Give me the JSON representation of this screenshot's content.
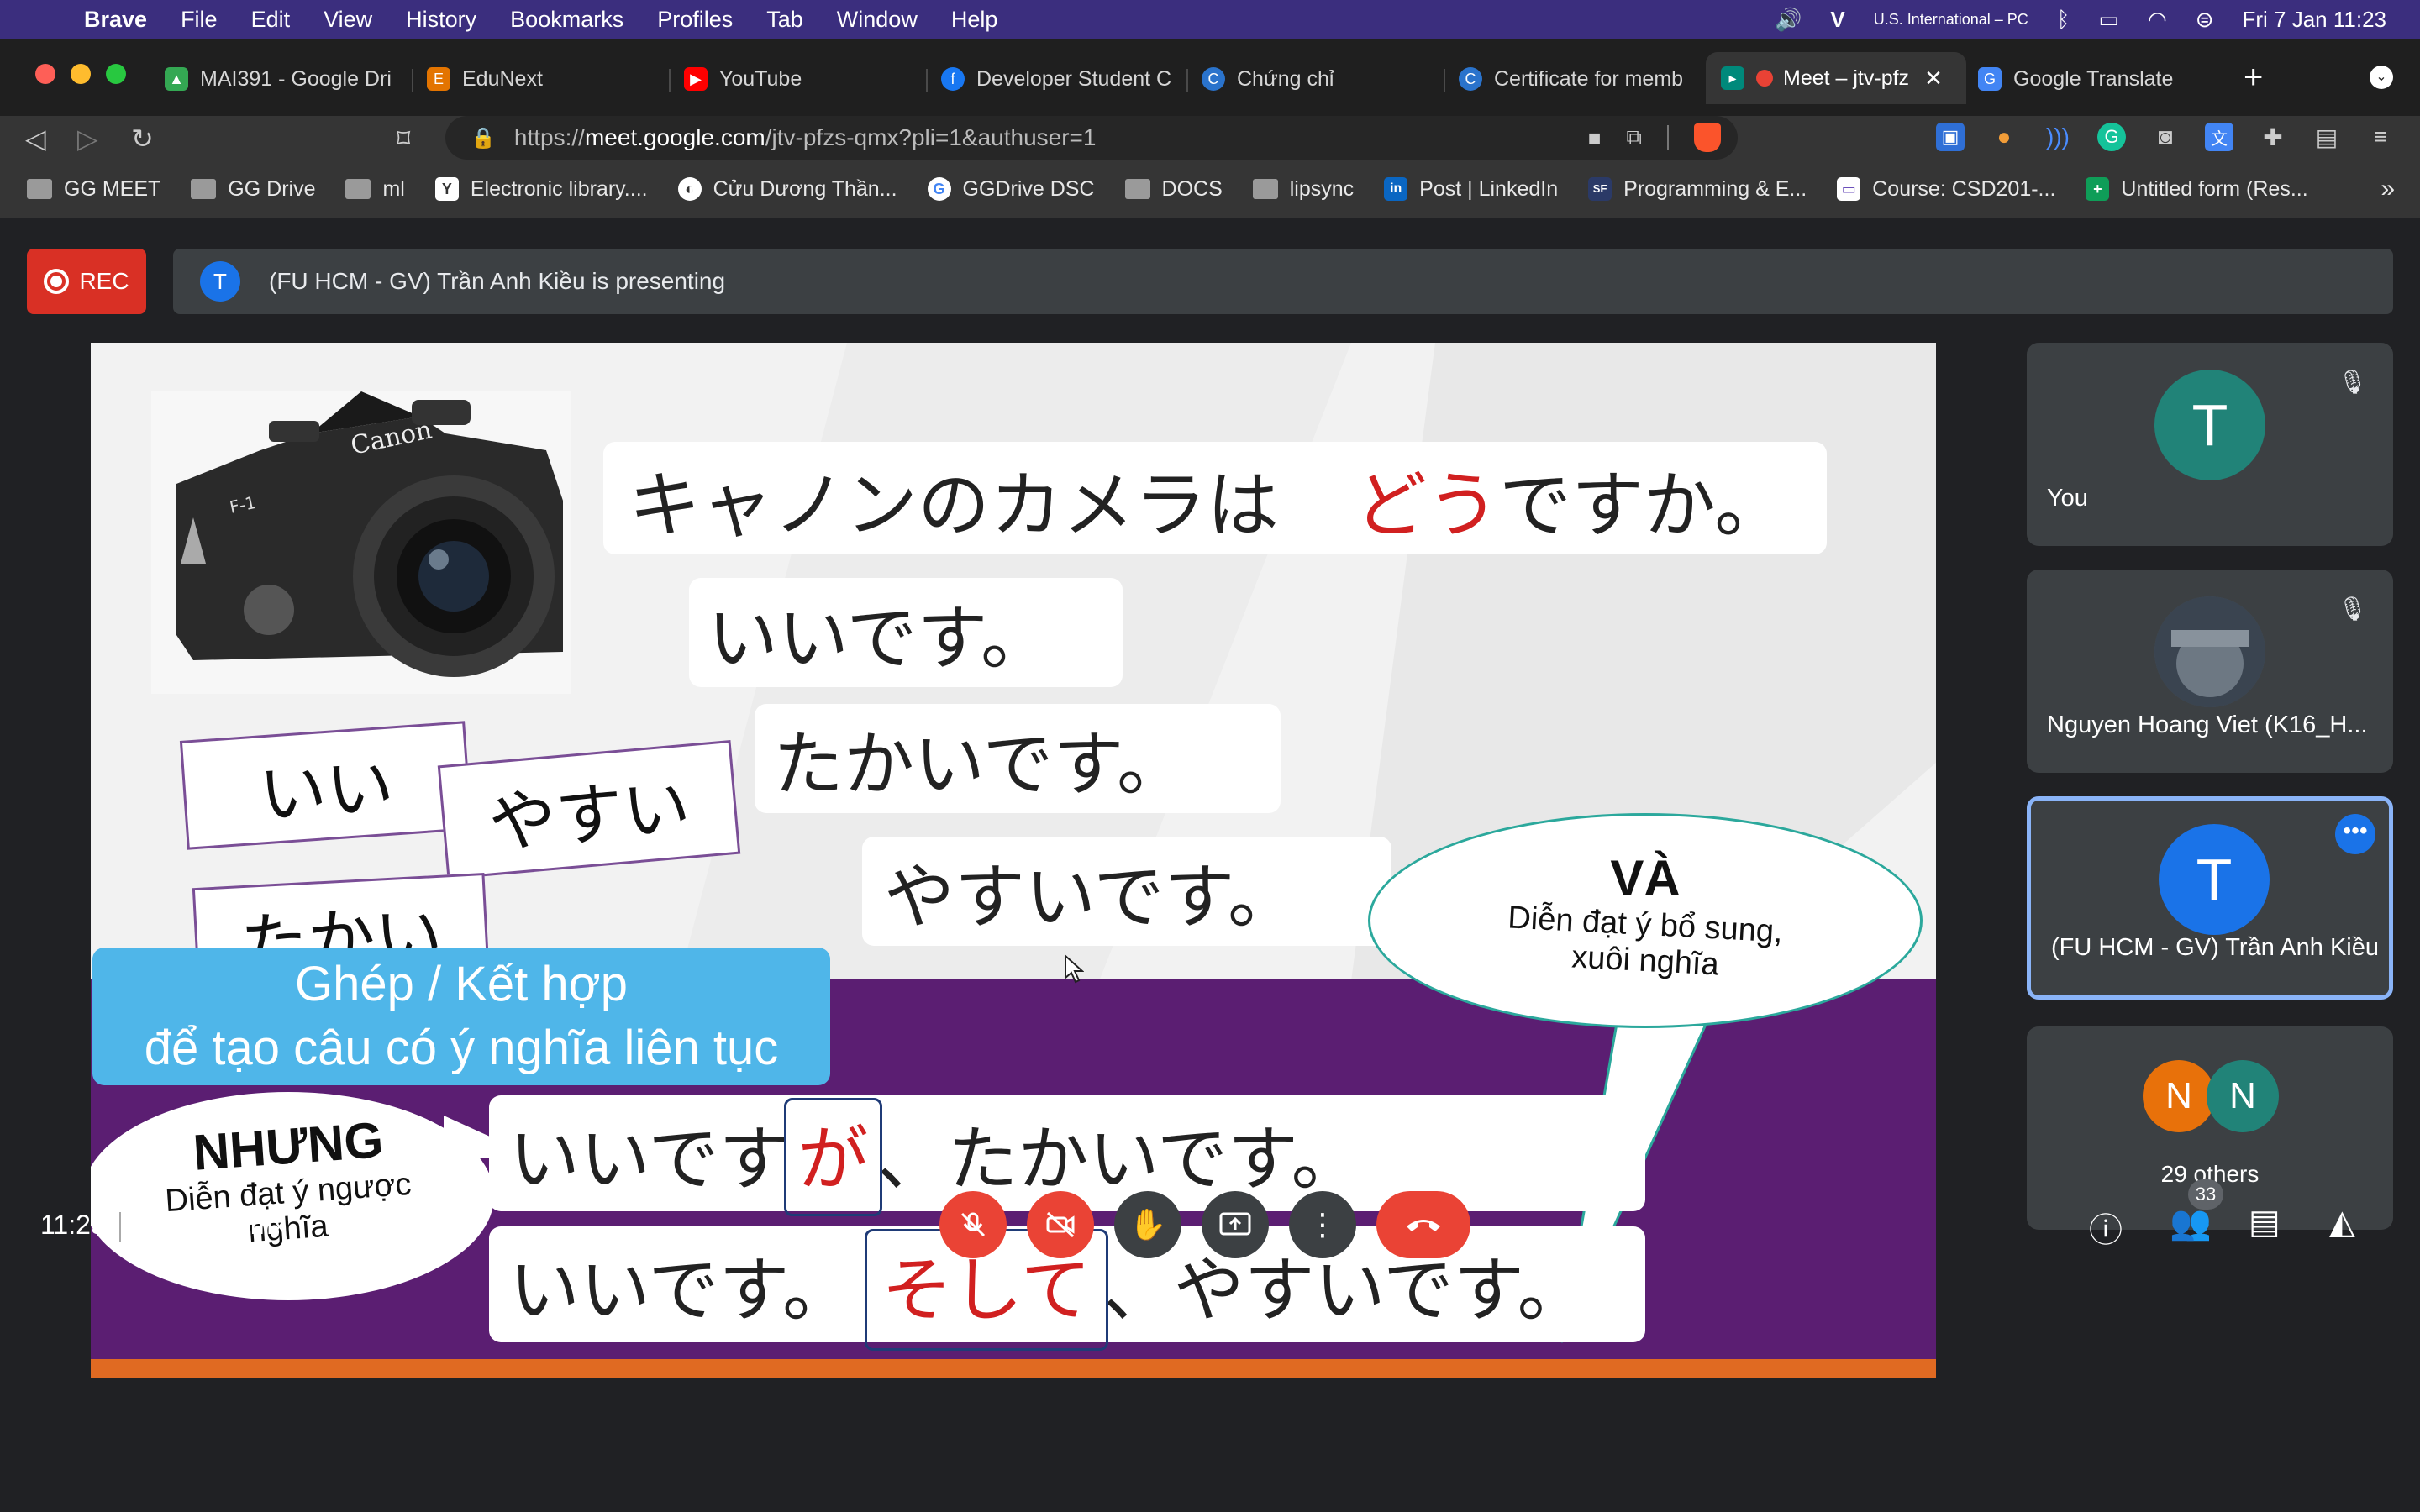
{
  "menubar": {
    "app": "Brave",
    "items": [
      "File",
      "Edit",
      "View",
      "History",
      "Bookmarks",
      "Profiles",
      "Tab",
      "Window",
      "Help"
    ],
    "keyboard": "U.S. International – PC",
    "datetime": "Fri 7 Jan  11:23"
  },
  "tabs": [
    {
      "title": "MAI391 - Google Dri",
      "icon": "google-drive-icon",
      "color": "#34a853"
    },
    {
      "title": "EduNext",
      "icon": "edunext-icon",
      "color": "#e37400"
    },
    {
      "title": "YouTube",
      "icon": "youtube-icon",
      "color": "#ff0000"
    },
    {
      "title": "Developer Student C",
      "icon": "facebook-icon",
      "color": "#1877f2"
    },
    {
      "title": "Chứng chỉ",
      "icon": "coursera-icon",
      "color": "#2a73cc"
    },
    {
      "title": "Certificate for memb",
      "icon": "coursera-icon",
      "color": "#2a73cc"
    },
    {
      "title": "Meet – jtv-pfz",
      "icon": "google-meet-icon",
      "color": "#00897b",
      "active": true
    },
    {
      "title": "Google Translate",
      "icon": "google-translate-icon",
      "color": "#4285f4"
    }
  ],
  "address": {
    "scheme": "https://",
    "host": "meet.google.com",
    "path": "/jtv-pfzs-qmx?pli=1&authuser=1"
  },
  "bookmarks": [
    {
      "label": "GG MEET",
      "type": "folder"
    },
    {
      "label": "GG Drive",
      "type": "folder"
    },
    {
      "label": "ml",
      "type": "folder"
    },
    {
      "label": "Electronic library....",
      "type": "site",
      "glyph": "Y",
      "color": "#ffffff"
    },
    {
      "label": "Cửu Dương Thần...",
      "type": "site",
      "glyph": "◐",
      "color": "#ffffff"
    },
    {
      "label": "GGDrive DSC",
      "type": "site",
      "glyph": "G",
      "color": "#ffffff"
    },
    {
      "label": "DOCS",
      "type": "folder"
    },
    {
      "label": "lipsync",
      "type": "folder"
    },
    {
      "label": "Post | LinkedIn",
      "type": "site",
      "glyph": "in",
      "color": "#0a66c2"
    },
    {
      "label": "Programming & E...",
      "type": "site",
      "glyph": "SF",
      "color": "#2b3a67"
    },
    {
      "label": "Course: CSD201-...",
      "type": "site",
      "glyph": "▭",
      "color": "#ffffff"
    },
    {
      "label": "Untitled form (Res...",
      "type": "site",
      "glyph": "+",
      "color": "#0f9d58"
    }
  ],
  "meet": {
    "rec_label": "REC",
    "presenter_initial": "T",
    "presenting_text": "(FU HCM - GV) Trần Anh Kiều is presenting",
    "meeting_time": "11:23",
    "meeting_code": "jtv-pfzs-qmx",
    "people_count": "33"
  },
  "slide": {
    "q1_pre": "キャノンのカメラは",
    "q1_red": "どう",
    "q1_post": "ですか。",
    "a1": "いいです。",
    "a2": "たかいです。",
    "a3": "やすいです。",
    "card1": "いい",
    "card2": "やすい",
    "card3": "たかい",
    "blue_line1": "Ghép / Kết hợp",
    "blue_line2": "để tạo câu có ý nghĩa liên tục",
    "va_title": "VÀ",
    "va_line1": "Diễn đạt ý bổ sung,",
    "va_line2": "xuôi nghĩa",
    "nhung_title": "NHƯNG",
    "nhung_line1": "Diễn đạt ý ngược",
    "nhung_line2": "nghĩa",
    "s1_pre": "いいです",
    "s1_red": "が",
    "s1_post": "、たかいです。",
    "s2_pre": "いいです。",
    "s2_red": "そして",
    "s2_post": "、やすいです。",
    "camera_brand": "Canon",
    "camera_model": "F-1"
  },
  "participants": [
    {
      "initial": "T",
      "name": "You",
      "color": "#218378",
      "muted": true
    },
    {
      "initial": "",
      "name": "Nguyen Hoang Viet (K16_H...",
      "color": "#555c63",
      "muted": true
    },
    {
      "initial": "T",
      "name": "(FU HCM - GV) Trần Anh Kiều",
      "color": "#1a73e8",
      "muted": false,
      "active": true
    }
  ],
  "others": {
    "initial1": "N",
    "color1": "#e8710a",
    "initial2": "N",
    "color2": "#218378",
    "label": "29 others"
  }
}
